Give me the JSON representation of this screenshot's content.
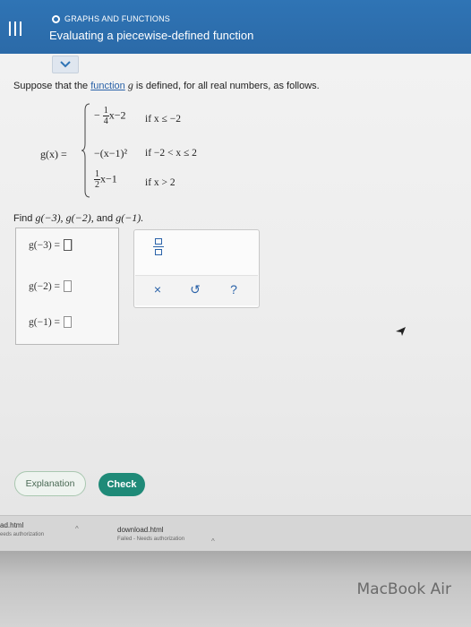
{
  "header": {
    "topic": "GRAPHS AND FUNCTIONS",
    "title": "Evaluating a piecewise-defined function",
    "collapse_icon": "chevron-down-icon"
  },
  "question": {
    "prefix": "Suppose that the ",
    "link": "function",
    "var": "g",
    "suffix": " is defined, for all real numbers, as follows."
  },
  "piecewise": {
    "lhs": "g(x) =",
    "cases": [
      {
        "neg": "−",
        "frac_num": "1",
        "frac_den": "4",
        "expr": "x−2",
        "cond": "if x ≤ −2"
      },
      {
        "expr": "−(x−1)²",
        "cond": "if −2 < x ≤ 2"
      },
      {
        "frac_num": "1",
        "frac_den": "2",
        "expr": "x−1",
        "cond": "if x > 2"
      }
    ]
  },
  "find": {
    "label": "Find",
    "items": [
      "g(−3),",
      "g(−2),",
      "and",
      "g(−1)."
    ]
  },
  "answers": [
    {
      "label": "g(−3) ="
    },
    {
      "label": "g(−2) ="
    },
    {
      "label": "g(−1) ="
    }
  ],
  "tools": {
    "fraction_icon": "fraction-icon",
    "clear": "×",
    "undo": "↺",
    "help": "?"
  },
  "buttons": {
    "explanation": "Explanation",
    "check": "Check"
  },
  "downloads": [
    {
      "name": "ad.html",
      "status": "eeds authorization"
    },
    {
      "name": "download.html",
      "status": "Failed - Needs authorization"
    }
  ],
  "brand": "MacBook Air"
}
